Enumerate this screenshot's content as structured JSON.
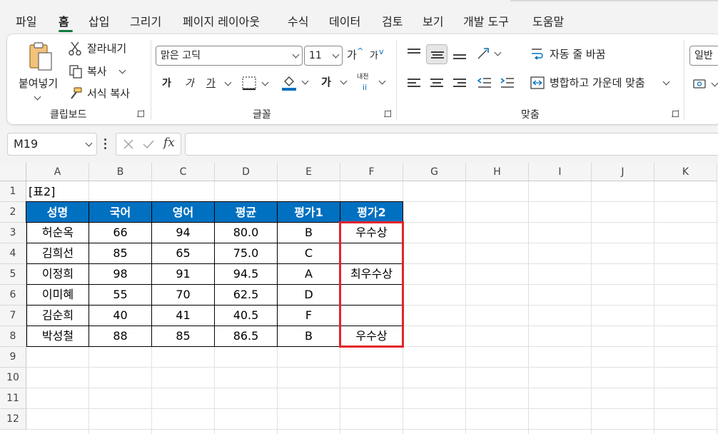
{
  "menu": {
    "tabs": [
      "파일",
      "홈",
      "삽입",
      "그리기",
      "페이지 레이아웃",
      "수식",
      "데이터",
      "검토",
      "보기",
      "개발 도구",
      "도움말"
    ],
    "active": "홈"
  },
  "ribbon": {
    "clipboard": {
      "paste_label": "붙여넣기",
      "cut_label": "잘라내기",
      "copy_label": "복사",
      "format_painter_label": "서식 복사",
      "group_label": "클립보드"
    },
    "font": {
      "font_name": "맑은 고딕",
      "font_size": "11",
      "grow_glyph": "가",
      "shrink_glyph": "가",
      "bold_glyph": "가",
      "italic_glyph": "가",
      "underline_glyph": "가",
      "font_color_glyph": "가",
      "phonetic_glyph": "내천",
      "group_label": "글꼴",
      "font_color": "#0070c0"
    },
    "alignment": {
      "wrap_text_label": "자동 줄 바꿈",
      "merge_center_label": "병합하고 가운데 맞춤",
      "group_label": "맞춤"
    },
    "number": {
      "format_value": "일반"
    }
  },
  "formula_bar": {
    "name_box": "M19",
    "fx_label": "fx",
    "formula": ""
  },
  "sheet": {
    "columns": [
      "A",
      "B",
      "C",
      "D",
      "E",
      "F",
      "G",
      "H",
      "I",
      "J",
      "K"
    ],
    "rows": [
      "1",
      "2",
      "3",
      "4",
      "5",
      "6",
      "7",
      "8",
      "9",
      "10",
      "11",
      "12"
    ],
    "table_title": "[표2]",
    "headers": [
      "성명",
      "국어",
      "영어",
      "평균",
      "평가1",
      "평가2"
    ],
    "data": [
      [
        "허순옥",
        "66",
        "94",
        "80.0",
        "B",
        "우수상"
      ],
      [
        "김희선",
        "85",
        "65",
        "75.0",
        "C",
        ""
      ],
      [
        "이정희",
        "98",
        "91",
        "94.5",
        "A",
        "최우수상"
      ],
      [
        "이미혜",
        "55",
        "70",
        "62.5",
        "D",
        ""
      ],
      [
        "김순희",
        "40",
        "41",
        "40.5",
        "F",
        ""
      ],
      [
        "박성철",
        "88",
        "85",
        "86.5",
        "B",
        "우수상"
      ]
    ],
    "header_fill": "#0070c0",
    "highlight_color": "#e3242b"
  }
}
